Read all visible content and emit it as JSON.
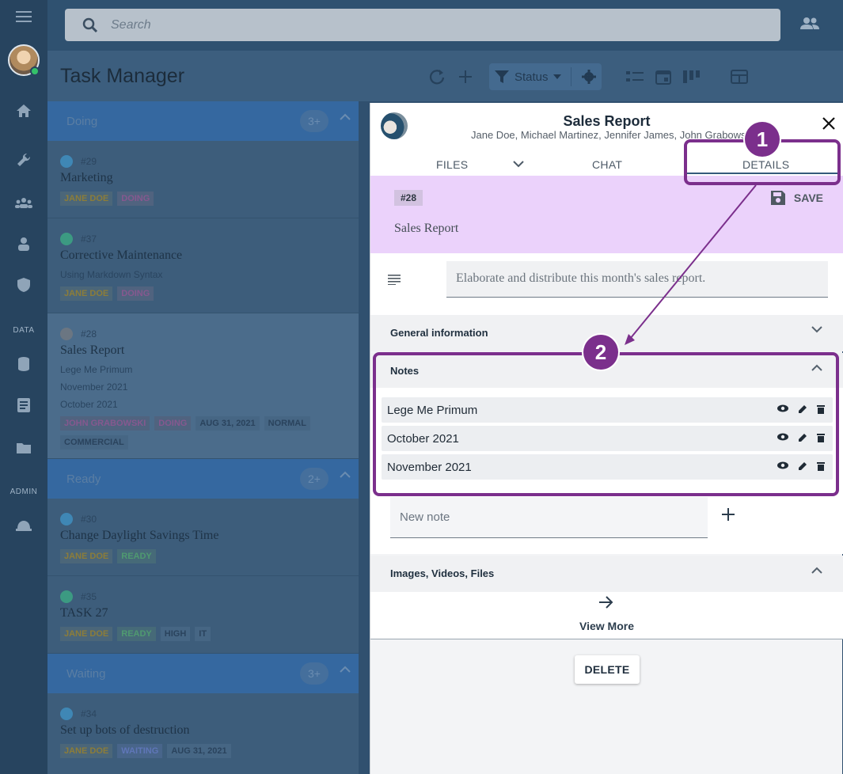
{
  "search": {
    "placeholder": "Search"
  },
  "rail": {
    "section_data": "DATA",
    "section_admin": "ADMIN"
  },
  "header": {
    "title": "Task Manager",
    "status_filter": "Status"
  },
  "list": {
    "groups": [
      {
        "name": "Doing",
        "count": "3+"
      },
      {
        "name": "Ready",
        "count": "2+"
      },
      {
        "name": "Waiting",
        "count": "3+"
      }
    ],
    "cards": [
      {
        "id": "#29",
        "title": "Marketing",
        "tags": [
          "JANE DOE",
          "DOING"
        ]
      },
      {
        "id": "#37",
        "title": "Corrective Maintenance",
        "sub": [
          "Using Markdown Syntax"
        ],
        "tags": [
          "JANE DOE",
          "DOING"
        ]
      },
      {
        "id": "#28",
        "title": "Sales Report",
        "sub": [
          "Lege Me Primum",
          "November 2021",
          "October 2021"
        ],
        "tags": [
          "JOHN GRABOWSKI",
          "DOING",
          "AUG 31, 2021",
          "NORMAL",
          "COMMERCIAL"
        ]
      },
      {
        "id": "#30",
        "title": "Change Daylight Savings Time",
        "tags": [
          "JANE DOE",
          "READY"
        ]
      },
      {
        "id": "#35",
        "title": "TASK 27",
        "tags": [
          "JANE DOE",
          "READY",
          "HIGH",
          "IT"
        ]
      },
      {
        "id": "#34",
        "title": "Set up bots of destruction",
        "tags": [
          "JANE DOE",
          "WAITING",
          "AUG 31, 2021"
        ]
      }
    ]
  },
  "panel": {
    "title": "Sales Report",
    "members": "Jane Doe, Michael Martinez, Jennifer James, John Grabowski",
    "tabs": {
      "files": "FILES",
      "chat": "CHAT",
      "details": "DETAILS"
    },
    "task_id": "#28",
    "save_label": "SAVE",
    "task_title": "Sales Report",
    "description": "Elaborate and distribute this month's sales report.",
    "sections": {
      "general": "General information",
      "notes": "Notes",
      "media": "Images, Videos, Files"
    },
    "notes": [
      "Lege Me Primum",
      "October 2021",
      "November 2021"
    ],
    "new_note_placeholder": "New note",
    "view_more": "View More",
    "delete_label": "DELETE"
  },
  "annotations": {
    "callout_1": "1",
    "callout_2": "2",
    "color": "#7b2f8c"
  }
}
